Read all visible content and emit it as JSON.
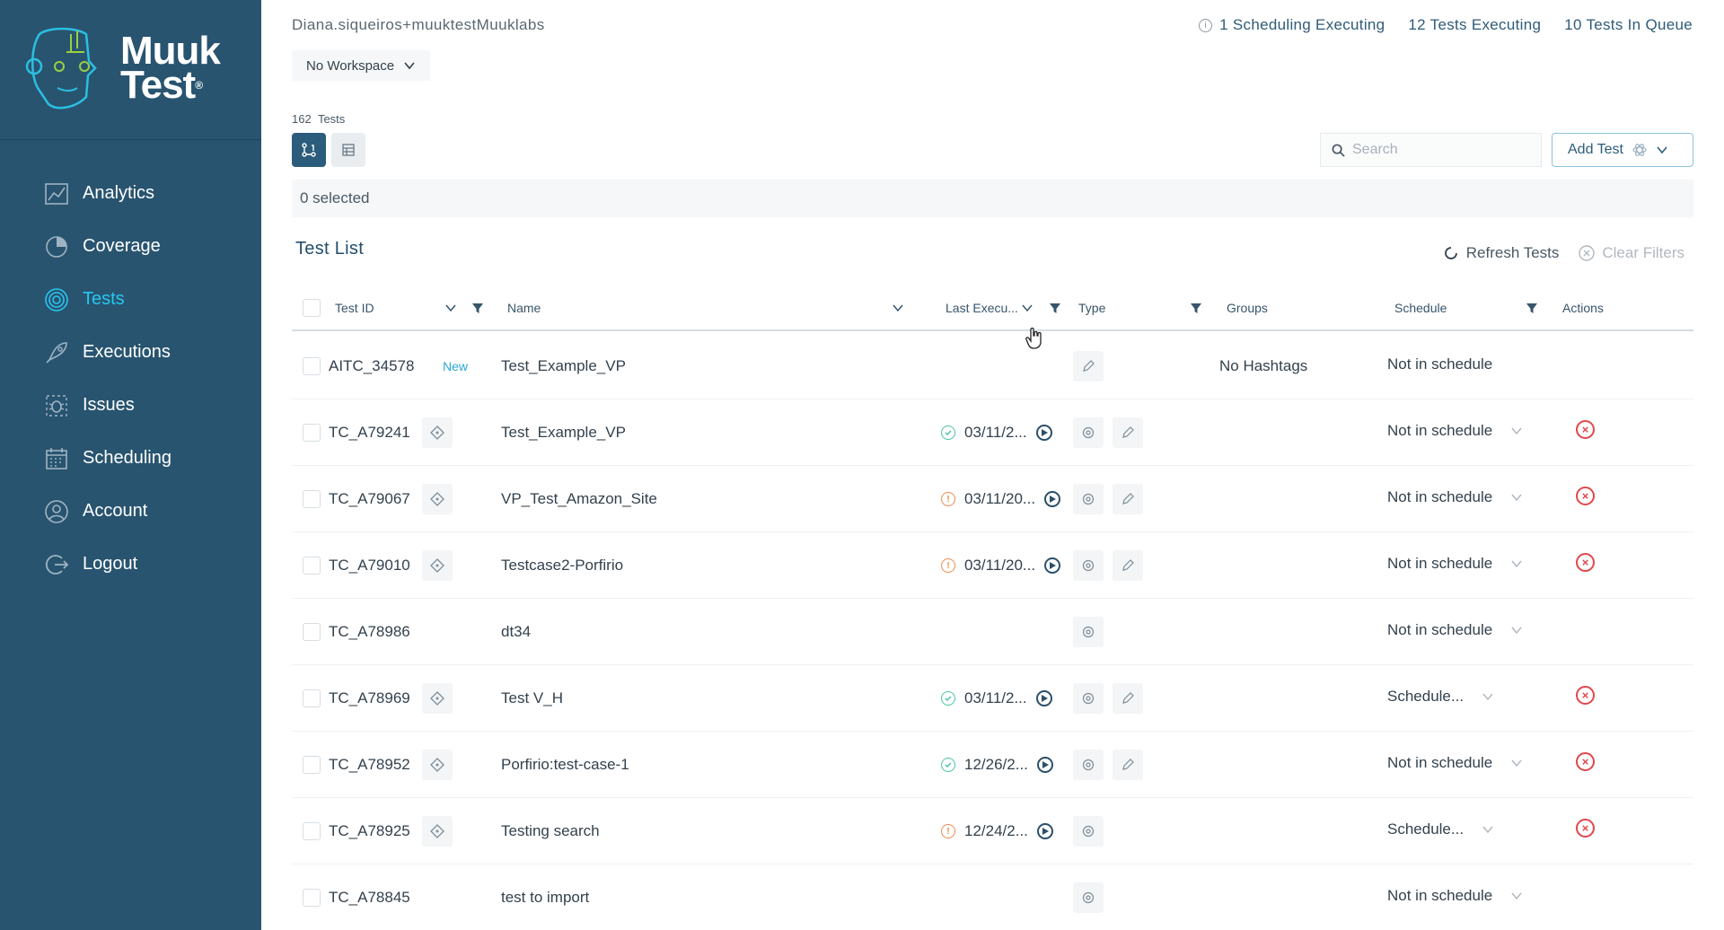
{
  "app": {
    "logo_line1": "Muuk",
    "logo_line2": "Test",
    "logo_mark": "®"
  },
  "sidebar": {
    "items": [
      {
        "label": "Analytics",
        "icon": "analytics-icon"
      },
      {
        "label": "Coverage",
        "icon": "coverage-icon"
      },
      {
        "label": "Tests",
        "icon": "tests-icon",
        "active": true
      },
      {
        "label": "Executions",
        "icon": "rocket-icon"
      },
      {
        "label": "Issues",
        "icon": "bug-icon"
      },
      {
        "label": "Scheduling",
        "icon": "calendar-icon"
      },
      {
        "label": "Account",
        "icon": "account-icon"
      },
      {
        "label": "Logout",
        "icon": "logout-icon"
      }
    ]
  },
  "header": {
    "user": "Diana.siqueiros+muuktestMuuklabs",
    "scheduling_executing": "1 Scheduling Executing",
    "tests_executing": "12 Tests Executing",
    "tests_in_queue": "10 Tests In Queue",
    "workspace": "No Workspace"
  },
  "toolbar": {
    "tests_count": "162",
    "tests_label": "Tests",
    "search_placeholder": "Search",
    "add_test_label": "Add Test",
    "selected_text": "0 selected"
  },
  "list": {
    "title": "Test List",
    "refresh_label": "Refresh Tests",
    "clear_label": "Clear Filters",
    "columns": {
      "test_id": "Test ID",
      "name": "Name",
      "last_execution": "Last Execu...",
      "type": "Type",
      "groups": "Groups",
      "schedule": "Schedule",
      "actions": "Actions"
    },
    "rows": [
      {
        "id": "AITC_34578",
        "badge": "New",
        "name": "Test_Example_VP",
        "status": "",
        "date": "",
        "groups": "No Hashtags",
        "schedule": "Not in schedule"
      },
      {
        "id": "TC_A79241",
        "name": "Test_Example_VP",
        "status": "ok",
        "date": "03/11/2...",
        "groups": "",
        "schedule": "Not in schedule"
      },
      {
        "id": "TC_A79067",
        "name": "VP_Test_Amazon_Site",
        "status": "warn",
        "date": "03/11/20...",
        "groups": "",
        "schedule": "Not in schedule"
      },
      {
        "id": "TC_A79010",
        "name": "Testcase2-Porfirio",
        "status": "warn",
        "date": "03/11/20...",
        "groups": "",
        "schedule": "Not in schedule"
      },
      {
        "id": "TC_A78986",
        "name": "dt34",
        "status": "",
        "date": "",
        "groups": "",
        "schedule": "Not in schedule"
      },
      {
        "id": "TC_A78969",
        "name": "Test V_H",
        "status": "ok",
        "date": "03/11/2...",
        "groups": "",
        "schedule": "Schedule..."
      },
      {
        "id": "TC_A78952",
        "name": "Porfirio:test-case-1",
        "status": "ok",
        "date": "12/26/2...",
        "groups": "",
        "schedule": "Not in schedule"
      },
      {
        "id": "TC_A78925",
        "name": "Testing search",
        "status": "warn",
        "date": "12/24/2...",
        "groups": "",
        "schedule": "Schedule..."
      },
      {
        "id": "TC_A78845",
        "name": "test to import",
        "status": "",
        "date": "",
        "groups": "",
        "schedule": "Not in schedule"
      }
    ]
  },
  "colors": {
    "sidebar_bg": "#285470",
    "active_nav": "#28c6f0",
    "ok": "#49c4a2",
    "warn": "#f08a4b",
    "delete": "#e0474c"
  }
}
